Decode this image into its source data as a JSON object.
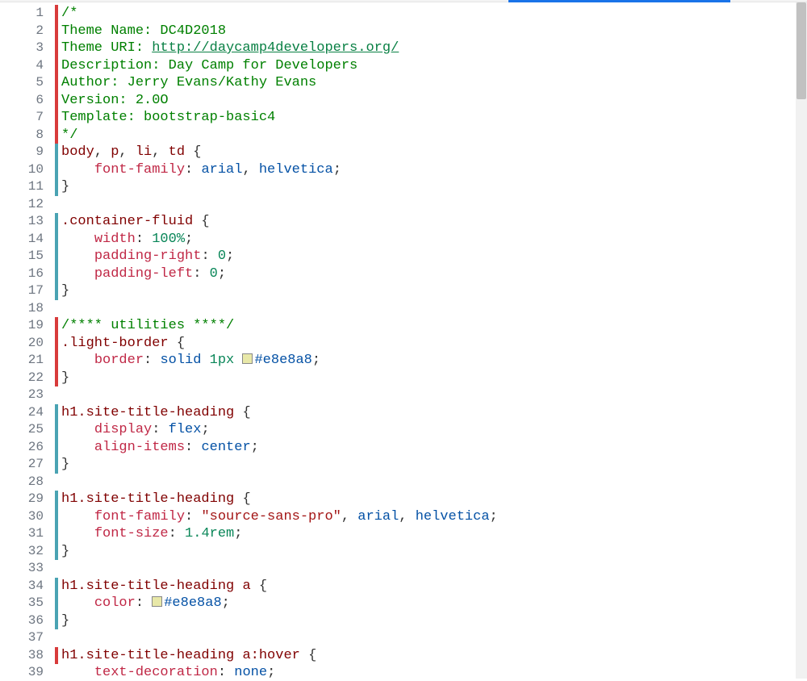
{
  "lines": [
    {
      "n": "1",
      "mark": "red",
      "tokens": [
        {
          "t": "/*",
          "c": "c-comment"
        }
      ]
    },
    {
      "n": "2",
      "mark": "red",
      "tokens": [
        {
          "t": "Theme Name: DC4D2018",
          "c": "c-comment"
        }
      ]
    },
    {
      "n": "3",
      "mark": "red",
      "tokens": [
        {
          "t": "Theme URI: ",
          "c": "c-comment"
        },
        {
          "t": "http://daycamp4developers.org/",
          "c": "c-url"
        }
      ]
    },
    {
      "n": "4",
      "mark": "red",
      "tokens": [
        {
          "t": "Description: Day Camp for Developers",
          "c": "c-comment"
        }
      ]
    },
    {
      "n": "5",
      "mark": "red",
      "tokens": [
        {
          "t": "Author: Jerry Evans/Kathy Evans",
          "c": "c-comment"
        }
      ]
    },
    {
      "n": "6",
      "mark": "red",
      "tokens": [
        {
          "t": "Version: 2.0O",
          "c": "c-comment"
        }
      ]
    },
    {
      "n": "7",
      "mark": "red",
      "tokens": [
        {
          "t": "Template: bootstrap-basic4",
          "c": "c-comment"
        }
      ]
    },
    {
      "n": "8",
      "mark": "red",
      "tokens": [
        {
          "t": "*/",
          "c": "c-comment"
        }
      ]
    },
    {
      "n": "9",
      "mark": "teal",
      "tokens": [
        {
          "t": "body",
          "c": "c-sel"
        },
        {
          "t": ", ",
          "c": "c-punc"
        },
        {
          "t": "p",
          "c": "c-sel"
        },
        {
          "t": ", ",
          "c": "c-punc"
        },
        {
          "t": "li",
          "c": "c-sel"
        },
        {
          "t": ", ",
          "c": "c-punc"
        },
        {
          "t": "td",
          "c": "c-sel"
        },
        {
          "t": " {",
          "c": "c-punc"
        }
      ]
    },
    {
      "n": "10",
      "mark": "teal",
      "tokens": [
        {
          "t": "    ",
          "c": ""
        },
        {
          "t": "font-family",
          "c": "c-prop"
        },
        {
          "t": ": ",
          "c": "c-punc"
        },
        {
          "t": "arial",
          "c": "c-val"
        },
        {
          "t": ", ",
          "c": "c-punc"
        },
        {
          "t": "helvetica",
          "c": "c-val"
        },
        {
          "t": ";",
          "c": "c-punc"
        }
      ]
    },
    {
      "n": "11",
      "mark": "teal",
      "tokens": [
        {
          "t": "}",
          "c": "c-punc"
        }
      ]
    },
    {
      "n": "12",
      "mark": "",
      "tokens": []
    },
    {
      "n": "13",
      "mark": "teal",
      "tokens": [
        {
          "t": ".container-fluid",
          "c": "c-class"
        },
        {
          "t": " {",
          "c": "c-punc"
        }
      ]
    },
    {
      "n": "14",
      "mark": "teal",
      "tokens": [
        {
          "t": "    ",
          "c": ""
        },
        {
          "t": "width",
          "c": "c-prop"
        },
        {
          "t": ": ",
          "c": "c-punc"
        },
        {
          "t": "100%",
          "c": "c-num"
        },
        {
          "t": ";",
          "c": "c-punc"
        }
      ]
    },
    {
      "n": "15",
      "mark": "teal",
      "tokens": [
        {
          "t": "    ",
          "c": ""
        },
        {
          "t": "padding-right",
          "c": "c-prop"
        },
        {
          "t": ": ",
          "c": "c-punc"
        },
        {
          "t": "0",
          "c": "c-num"
        },
        {
          "t": ";",
          "c": "c-punc"
        }
      ]
    },
    {
      "n": "16",
      "mark": "teal",
      "tokens": [
        {
          "t": "    ",
          "c": ""
        },
        {
          "t": "padding-left",
          "c": "c-prop"
        },
        {
          "t": ": ",
          "c": "c-punc"
        },
        {
          "t": "0",
          "c": "c-num"
        },
        {
          "t": ";",
          "c": "c-punc"
        }
      ]
    },
    {
      "n": "17",
      "mark": "teal",
      "tokens": [
        {
          "t": "}",
          "c": "c-punc"
        }
      ]
    },
    {
      "n": "18",
      "mark": "",
      "tokens": []
    },
    {
      "n": "19",
      "mark": "red",
      "tokens": [
        {
          "t": "/**** utilities ****/",
          "c": "c-comment"
        }
      ]
    },
    {
      "n": "20",
      "mark": "red",
      "tokens": [
        {
          "t": ".light-border",
          "c": "c-class"
        },
        {
          "t": " {",
          "c": "c-punc"
        }
      ]
    },
    {
      "n": "21",
      "mark": "red",
      "tokens": [
        {
          "t": "    ",
          "c": ""
        },
        {
          "t": "border",
          "c": "c-prop"
        },
        {
          "t": ": ",
          "c": "c-punc"
        },
        {
          "t": "solid",
          "c": "c-val"
        },
        {
          "t": " ",
          "c": ""
        },
        {
          "t": "1px",
          "c": "c-num"
        },
        {
          "t": " ",
          "c": ""
        },
        {
          "swatch": "sw-e8e8a8"
        },
        {
          "t": "#e8e8a8",
          "c": "c-hex"
        },
        {
          "t": ";",
          "c": "c-punc"
        }
      ]
    },
    {
      "n": "22",
      "mark": "red",
      "tokens": [
        {
          "t": "}",
          "c": "c-punc"
        }
      ]
    },
    {
      "n": "23",
      "mark": "",
      "tokens": []
    },
    {
      "n": "24",
      "mark": "teal",
      "tokens": [
        {
          "t": "h1",
          "c": "c-sel"
        },
        {
          "t": ".site-title-heading",
          "c": "c-class"
        },
        {
          "t": " {",
          "c": "c-punc"
        }
      ]
    },
    {
      "n": "25",
      "mark": "teal",
      "tokens": [
        {
          "t": "    ",
          "c": ""
        },
        {
          "t": "display",
          "c": "c-prop"
        },
        {
          "t": ": ",
          "c": "c-punc"
        },
        {
          "t": "flex",
          "c": "c-val"
        },
        {
          "t": ";",
          "c": "c-punc"
        }
      ]
    },
    {
      "n": "26",
      "mark": "teal",
      "tokens": [
        {
          "t": "    ",
          "c": ""
        },
        {
          "t": "align-items",
          "c": "c-prop"
        },
        {
          "t": ": ",
          "c": "c-punc"
        },
        {
          "t": "center",
          "c": "c-val"
        },
        {
          "t": ";",
          "c": "c-punc"
        }
      ]
    },
    {
      "n": "27",
      "mark": "teal",
      "tokens": [
        {
          "t": "}",
          "c": "c-punc"
        }
      ]
    },
    {
      "n": "28",
      "mark": "",
      "tokens": []
    },
    {
      "n": "29",
      "mark": "teal",
      "tokens": [
        {
          "t": "h1",
          "c": "c-sel"
        },
        {
          "t": ".site-title-heading",
          "c": "c-class"
        },
        {
          "t": " {",
          "c": "c-punc"
        }
      ]
    },
    {
      "n": "30",
      "mark": "teal",
      "tokens": [
        {
          "t": "    ",
          "c": ""
        },
        {
          "t": "font-family",
          "c": "c-prop"
        },
        {
          "t": ": ",
          "c": "c-punc"
        },
        {
          "t": "\"source-sans-pro\"",
          "c": "c-str"
        },
        {
          "t": ", ",
          "c": "c-punc"
        },
        {
          "t": "arial",
          "c": "c-val"
        },
        {
          "t": ", ",
          "c": "c-punc"
        },
        {
          "t": "helvetica",
          "c": "c-val"
        },
        {
          "t": ";",
          "c": "c-punc"
        }
      ]
    },
    {
      "n": "31",
      "mark": "teal",
      "tokens": [
        {
          "t": "    ",
          "c": ""
        },
        {
          "t": "font-size",
          "c": "c-prop"
        },
        {
          "t": ": ",
          "c": "c-punc"
        },
        {
          "t": "1.4rem",
          "c": "c-num"
        },
        {
          "t": ";",
          "c": "c-punc"
        }
      ]
    },
    {
      "n": "32",
      "mark": "teal",
      "tokens": [
        {
          "t": "}",
          "c": "c-punc"
        }
      ]
    },
    {
      "n": "33",
      "mark": "",
      "tokens": []
    },
    {
      "n": "34",
      "mark": "teal",
      "tokens": [
        {
          "t": "h1",
          "c": "c-sel"
        },
        {
          "t": ".site-title-heading",
          "c": "c-class"
        },
        {
          "t": " ",
          "c": ""
        },
        {
          "t": "a",
          "c": "c-sel"
        },
        {
          "t": " {",
          "c": "c-punc"
        }
      ]
    },
    {
      "n": "35",
      "mark": "teal",
      "tokens": [
        {
          "t": "    ",
          "c": ""
        },
        {
          "t": "color",
          "c": "c-prop"
        },
        {
          "t": ": ",
          "c": "c-punc"
        },
        {
          "swatch": "sw-e8e8a8"
        },
        {
          "t": "#e8e8a8",
          "c": "c-hex"
        },
        {
          "t": ";",
          "c": "c-punc"
        }
      ]
    },
    {
      "n": "36",
      "mark": "teal",
      "tokens": [
        {
          "t": "}",
          "c": "c-punc"
        }
      ]
    },
    {
      "n": "37",
      "mark": "",
      "tokens": []
    },
    {
      "n": "38",
      "mark": "red",
      "tokens": [
        {
          "t": "h1",
          "c": "c-sel"
        },
        {
          "t": ".site-title-heading",
          "c": "c-class"
        },
        {
          "t": " ",
          "c": ""
        },
        {
          "t": "a",
          "c": "c-sel"
        },
        {
          "t": ":hover",
          "c": "c-pseudo"
        },
        {
          "t": " {",
          "c": "c-punc"
        }
      ]
    },
    {
      "n": "39",
      "mark": "",
      "tokens": [
        {
          "t": "    ",
          "c": ""
        },
        {
          "t": "text-decoration",
          "c": "c-prop"
        },
        {
          "t": ": ",
          "c": "c-punc"
        },
        {
          "t": "none",
          "c": "c-val"
        },
        {
          "t": ";",
          "c": "c-punc"
        }
      ]
    }
  ]
}
